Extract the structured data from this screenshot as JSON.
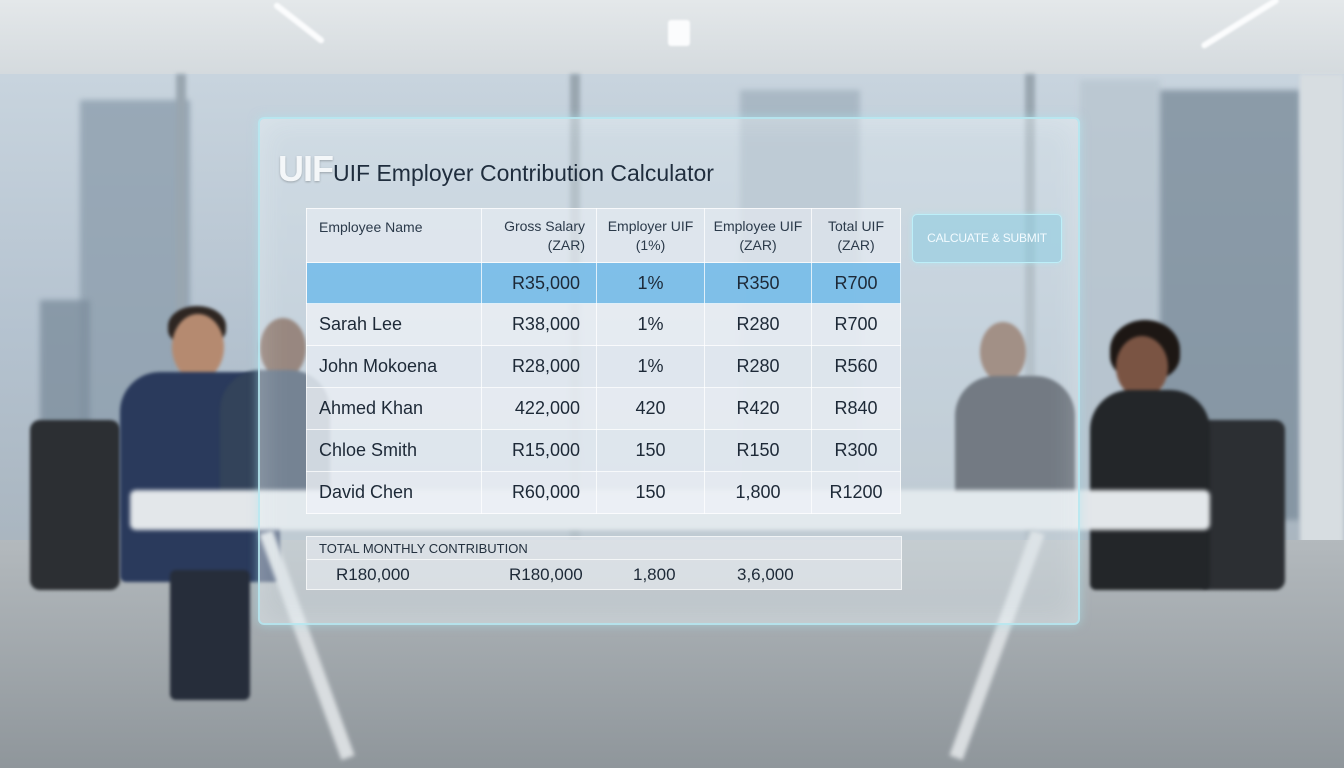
{
  "app": {
    "logo_text": "UIF",
    "title": "UIF Employer Contribution Calculator"
  },
  "table": {
    "headers": {
      "name": "Employee Name",
      "gross": "Gross Salary (ZAR)",
      "employer": "Employer UIF (1%)",
      "employee": "Employee UIF (ZAR)",
      "total": "Total UIF (ZAR)"
    },
    "rows": [
      {
        "name": "",
        "gross": "R35,000",
        "employer": "1%",
        "employee": "R350",
        "total": "R700"
      },
      {
        "name": "Sarah Lee",
        "gross": "R38,000",
        "employer": "1%",
        "employee": "R280",
        "total": "R700"
      },
      {
        "name": "John Mokoena",
        "gross": "R28,000",
        "employer": "1%",
        "employee": "R280",
        "total": "R560"
      },
      {
        "name": "Ahmed Khan",
        "gross": "422,000",
        "employer": "420",
        "employee": "R420",
        "total": "R840"
      },
      {
        "name": "Chloe Smith",
        "gross": "R15,000",
        "employer": "150",
        "employee": "R150",
        "total": "R300"
      },
      {
        "name": "David Chen",
        "gross": "R60,000",
        "employer": "150",
        "employee": "1,800",
        "total": "R1200"
      }
    ]
  },
  "actions": {
    "calculate_label": "CALCUATE & SUBMIT"
  },
  "totals": {
    "label": "TOTAL MONTHLY CONTRIBUTION",
    "values": [
      "R180,000",
      "R180,000",
      "1,800",
      "3,6,000"
    ]
  },
  "colors": {
    "accent_row": "#6eb9e8",
    "panel_border": "#b4e8f0",
    "button_fill": "#8ccde1"
  }
}
